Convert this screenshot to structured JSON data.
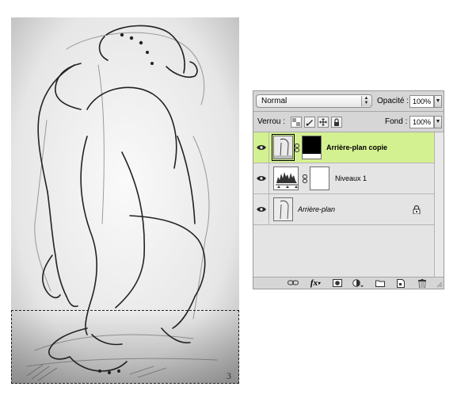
{
  "layers_panel": {
    "blend_mode": "Normal",
    "opacity_label": "Opacité :",
    "opacity_value": "100%",
    "lock_label": "Verrou :",
    "fill_label": "Fond :",
    "fill_value": "100%",
    "layers": [
      {
        "name": "Arrière-plan copie",
        "visible": true,
        "selected": true,
        "has_mask": true
      },
      {
        "name": "Niveaux 1",
        "visible": true,
        "selected": false,
        "type": "adjustment-levels"
      },
      {
        "name": "Arrière-plan",
        "visible": true,
        "selected": false,
        "locked": true
      }
    ],
    "bottom_icons": [
      "link-icon",
      "fx-icon",
      "add-mask-icon",
      "adjustment-layer-icon",
      "new-group-icon",
      "new-layer-icon",
      "trash-icon"
    ]
  },
  "artwork": {
    "signature": "3"
  },
  "colors": {
    "selected_layer": "#d4f191",
    "panel_bg": "#d6d6d6"
  }
}
